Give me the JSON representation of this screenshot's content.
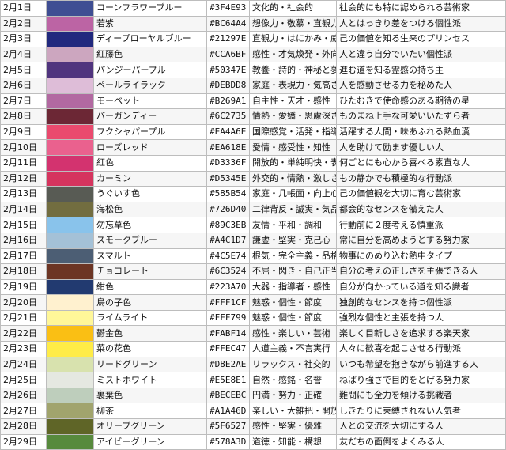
{
  "rows": [
    {
      "date": "2月1日",
      "color_name": "コーンフラワーブルー",
      "hex": "#3F4E93",
      "traits": "文化的・社会的",
      "description": "社会的にも特に認められる芸術家"
    },
    {
      "date": "2月2日",
      "color_name": "若紫",
      "hex": "#BC64A4",
      "traits": "想像力・敬慕・直観力",
      "description": "人とはっきり差をつける個性派"
    },
    {
      "date": "2月3日",
      "color_name": "ディープローヤルブルー",
      "hex": "#21297E",
      "traits": "直観力・はにかみ・威厳",
      "description": "己の価値を知る生来のプリンセス"
    },
    {
      "date": "2月4日",
      "color_name": "紅藤色",
      "hex": "#CCA6BF",
      "traits": "感性・才気煥発・外向性",
      "description": "人と違う自分でいたい個性派"
    },
    {
      "date": "2月5日",
      "color_name": "パンジーパープル",
      "hex": "#50347E",
      "traits": "教養・詩的・神秘と夢幻",
      "description": "進む道を知る霊感の持ち主"
    },
    {
      "date": "2月6日",
      "color_name": "ペールライラック",
      "hex": "#DEBDD8",
      "traits": "家庭・表現力・気高さ",
      "description": "人を感動させる力を秘めた人"
    },
    {
      "date": "2月7日",
      "color_name": "モーベット",
      "hex": "#B269A1",
      "traits": "自主性・天才・感性",
      "description": "ひたむきで使命感のある期待の星"
    },
    {
      "date": "2月8日",
      "color_name": "バーガンディー",
      "hex": "#6C2735",
      "traits": "情熱・愛嬌・思慮深さ",
      "description": "ものまね上手な可愛いいたずら者"
    },
    {
      "date": "2月9日",
      "color_name": "フクシャパープル",
      "hex": "#EA4A6E",
      "traits": "国際感覚・活発・指導者",
      "description": "活躍する人間・味あふれる熱血漢"
    },
    {
      "date": "2月10日",
      "color_name": "ローズレッド",
      "hex": "#EA618E",
      "traits": "愛情・感受性・知性",
      "description": "人を助けて励ます優しい人"
    },
    {
      "date": "2月11日",
      "color_name": "紅色",
      "hex": "#D3336F",
      "traits": "開放的・単純明快・表現",
      "description": "何ごとにも心から喜べる素直な人"
    },
    {
      "date": "2月12日",
      "color_name": "カーミン",
      "hex": "#D5345E",
      "traits": "外交的・情熱・激しさ",
      "description": "もの静かでも積極的な行動派"
    },
    {
      "date": "2月13日",
      "color_name": "うぐいす色",
      "hex": "#585B54",
      "traits": "家庭・几帳面・向上心",
      "description": "己の価値観を大切に育む芸術家"
    },
    {
      "date": "2月14日",
      "color_name": "海松色",
      "hex": "#726D40",
      "traits": "二律背反・誠実・気品",
      "description": "都会的なセンスを備えた人"
    },
    {
      "date": "2月15日",
      "color_name": "勿忘草色",
      "hex": "#89C3EB",
      "traits": "友情・平和・調和",
      "description": "行動前に２度考える慎重派"
    },
    {
      "date": "2月16日",
      "color_name": "スモークブルー",
      "hex": "#A4C1D7",
      "traits": "謙虚・堅実・克己心",
      "description": "常に自分を高めようとする努力家"
    },
    {
      "date": "2月17日",
      "color_name": "スマルト",
      "hex": "#4C5E74",
      "traits": "根気・完全主義・品格",
      "description": "物事にのめり込む熱中タイプ"
    },
    {
      "date": "2月18日",
      "color_name": "チョコレート",
      "hex": "#6C3524",
      "traits": "不屈・閃き・自己正当化",
      "description": "自分の考えの正しさを主張できる人"
    },
    {
      "date": "2月19日",
      "color_name": "紺色",
      "hex": "#223A70",
      "traits": "大器・指導者・感性",
      "description": "自分が向かっている道を知る識者"
    },
    {
      "date": "2月20日",
      "color_name": "鳥の子色",
      "hex": "#FFF1CF",
      "traits": "魅惑・個性・節度",
      "description": "独創的なセンスを持つ個性派"
    },
    {
      "date": "2月21日",
      "color_name": "ライムライト",
      "hex": "#FFF799",
      "traits": "魅惑・個性・節度",
      "description": "強烈な個性と主張を持つ人"
    },
    {
      "date": "2月22日",
      "color_name": "鬱金色",
      "hex": "#FABF14",
      "traits": "感性・楽しい・芸術",
      "description": "楽しく目新しさを追求する楽天家"
    },
    {
      "date": "2月23日",
      "color_name": "菜の花色",
      "hex": "#FFEC47",
      "traits": "人道主義・不言実行",
      "description": "人々に歓喜を起こさせる行動派"
    },
    {
      "date": "2月24日",
      "color_name": "リードグリーン",
      "hex": "#D8E2AE",
      "traits": "リラックス・社交的",
      "description": "いつも希望を抱きながら前進する人"
    },
    {
      "date": "2月25日",
      "color_name": "ミストホワイト",
      "hex": "#E5E8E1",
      "traits": "自然・感銘・名誉",
      "description": "ねばり強さで目的をとげる努力家"
    },
    {
      "date": "2月26日",
      "color_name": "裏葉色",
      "hex": "#BECEBC",
      "traits": "円満・努力・正確",
      "description": "難問にも全力を傾ける挑戦者"
    },
    {
      "date": "2月27日",
      "color_name": "柳茶",
      "hex": "#A1A46D",
      "traits": "楽しい・大雑把・開放",
      "description": "しきたりに束縛されない人気者"
    },
    {
      "date": "2月28日",
      "color_name": "オリーブグリーン",
      "hex": "#5F6527",
      "traits": "感性・堅実・優雅",
      "description": "人との交流を大切にする人"
    },
    {
      "date": "2月29日",
      "color_name": "アイビーグリーン",
      "hex": "#578A3D",
      "traits": "道徳・知能・構想",
      "description": "友だちの面倒をよくみる人"
    }
  ]
}
